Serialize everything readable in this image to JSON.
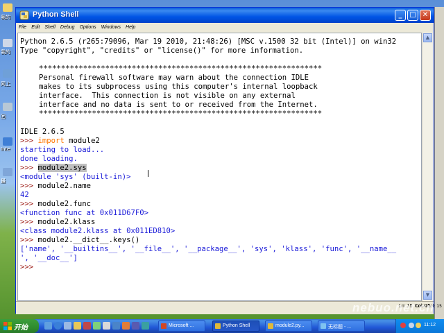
{
  "desktop": {
    "icons": [
      "我的",
      "我的",
      "网上",
      "回",
      "Inte",
      "最"
    ]
  },
  "window": {
    "title": "Python Shell",
    "menu": [
      "File",
      "Edit",
      "Shell",
      "Debug",
      "Options",
      "Windows",
      "Help"
    ]
  },
  "shell": {
    "banner1": "Python 2.6.5 (r265:79096, Mar 19 2010, 21:48:26) [MSC v.1500 32 bit (Intel)] on win32",
    "banner2": "Type \"copyright\", \"credits\" or \"license()\" for more information.",
    "stars": "****************************************************************",
    "fw1": "Personal firewall software may warn about the connection IDLE",
    "fw2": "makes to its subprocess using this computer's internal loopback",
    "fw3": "interface.  This connection is not visible on any external",
    "fw4": "interface and no data is sent to or received from the Internet.",
    "idle": "IDLE 2.6.5",
    "prompt": ">>> ",
    "kw_import": "import",
    "cmd1_rest": " module2",
    "out1": "starting to load...",
    "out2": "done loading.",
    "cmd2": "module2.sys",
    "out3": "<module 'sys' (built-in)>",
    "cmd3": "module2.name",
    "out4": "42",
    "cmd4": "module2.func",
    "out5": "<function func at 0x011D67F0>",
    "cmd5": "module2.klass",
    "out6": "<class module2.klass at 0x011ED810>",
    "cmd6": "module2.__dict__.keys()",
    "out7": "['name', '__builtins__', '__file__', '__package__', 'sys', 'klass', 'func', '__name__",
    "out8": "', '__doc__']",
    "last_prompt": ">>>"
  },
  "status": {
    "ln": "Ln: 15",
    "col": "Col: 15",
    "ln2": "Ln: 4 Col: 15"
  },
  "taskbar": {
    "start_label": "开始",
    "buttons": [
      "Microsoft ...",
      "Python Shell",
      "module2.py...",
      "无标题 - ..."
    ],
    "clock": "11:12"
  },
  "watermark": "nebuo.net.cn",
  "colors": {
    "prompt": "#a0231d",
    "output": "#1a1ad8",
    "keyword": "#ff7700",
    "titlebar": "#0055e5",
    "start_green": "#2f8c2f"
  }
}
